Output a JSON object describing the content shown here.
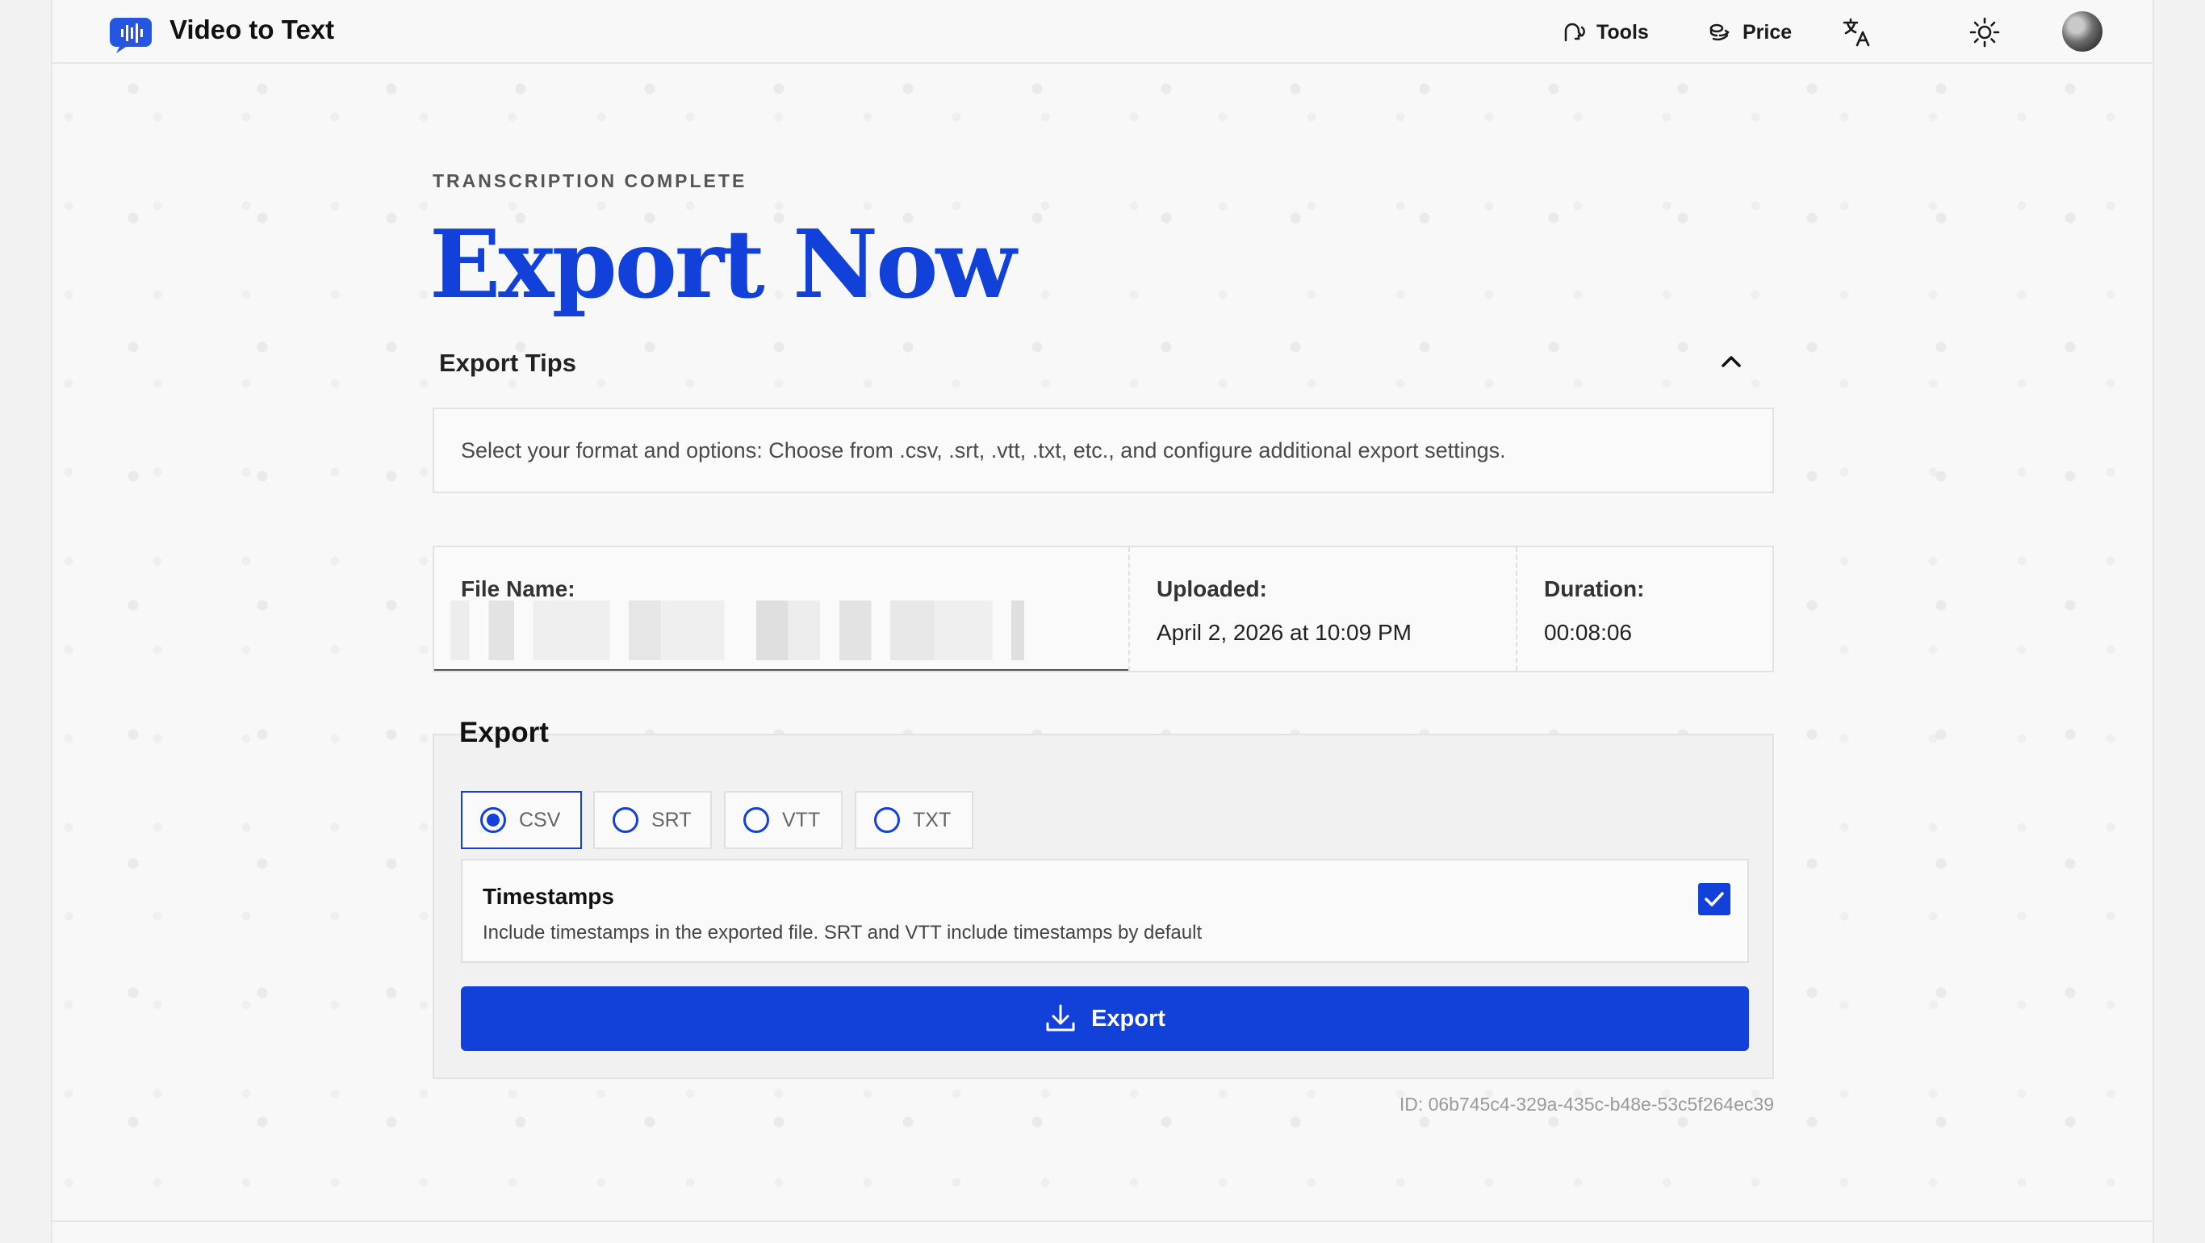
{
  "header": {
    "app_title": "Video to Text",
    "nav": [
      {
        "label": "Tools",
        "icon": "audio-head-icon"
      },
      {
        "label": "Price",
        "icon": "coins-icon"
      }
    ],
    "language_icon": "translate-icon",
    "theme_icon": "sun-icon",
    "avatar_icon": "user-avatar"
  },
  "main": {
    "eyebrow": "TRANSCRIPTION COMPLETE",
    "title": "Export Now",
    "tips": {
      "title": "Export Tips",
      "body": "Select your format and options: Choose from .csv, .srt, .vtt, .txt, etc., and configure additional export settings."
    },
    "file": {
      "name_label": "File Name:",
      "name_value": "",
      "uploaded_label": "Uploaded:",
      "uploaded_value": "April 2, 2026 at 10:09 PM",
      "duration_label": "Duration:",
      "duration_value": "00:08:06"
    },
    "export": {
      "title": "Export",
      "formats": [
        "CSV",
        "SRT",
        "VTT",
        "TXT"
      ],
      "selected_format": "CSV",
      "timestamps_title": "Timestamps",
      "timestamps_desc": "Include timestamps in the exported file. SRT and VTT include timestamps by default",
      "timestamps_checked": true,
      "button_label": "Export"
    },
    "record_id": "ID: 06b745c4-329a-435c-b48e-53c5f264ec39"
  },
  "colors": {
    "accent": "#1241d9",
    "background": "#f8f8f8"
  }
}
